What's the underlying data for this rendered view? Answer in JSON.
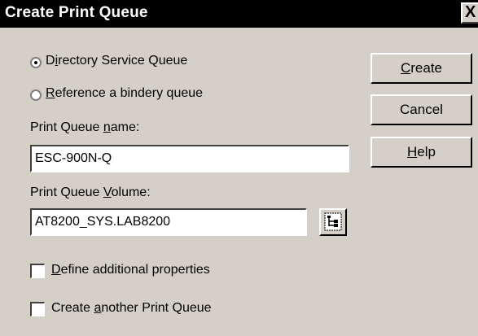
{
  "window": {
    "title": "Create Print Queue",
    "close_glyph": "X"
  },
  "queue_type": {
    "options": [
      {
        "pre": "D",
        "key": "i",
        "post": "rectory Service Queue",
        "selected": true
      },
      {
        "pre": "",
        "key": "R",
        "post": "eference a bindery queue",
        "selected": false
      }
    ]
  },
  "queue_name": {
    "label_pre": "Print Queue ",
    "label_key": "n",
    "label_post": "ame:",
    "value": "ESC-900N-Q"
  },
  "queue_volume": {
    "label_pre": "Print Queue ",
    "label_key": "V",
    "label_post": "olume:",
    "value": "AT8200_SYS.LAB8200",
    "browse_icon": "browse-tree-icon"
  },
  "options": {
    "define_additional": {
      "pre": "",
      "key": "D",
      "post": "efine additional properties",
      "checked": false
    },
    "create_another": {
      "pre": "Create ",
      "key": "a",
      "post": "nother Print Queue",
      "checked": false
    }
  },
  "buttons": {
    "create": {
      "pre": "",
      "key": "C",
      "post": "reate"
    },
    "cancel": {
      "pre": "Cancel",
      "key": "",
      "post": ""
    },
    "help": {
      "pre": "",
      "key": "H",
      "post": "elp"
    }
  },
  "colors": {
    "dialog_bg": "#d4d0c8",
    "titlebar_bg": "#000000",
    "titlebar_text": "#ffffff"
  }
}
